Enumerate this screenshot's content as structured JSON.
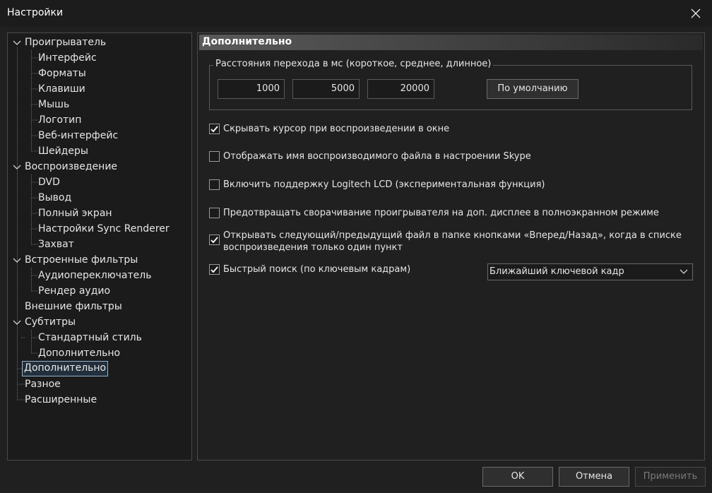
{
  "window": {
    "title": "Настройки"
  },
  "tree": {
    "items": [
      {
        "label": "Проигрыватель"
      },
      {
        "label": "Интерфейс"
      },
      {
        "label": "Форматы"
      },
      {
        "label": "Клавиши"
      },
      {
        "label": "Мышь"
      },
      {
        "label": "Логотип"
      },
      {
        "label": "Веб-интерфейс"
      },
      {
        "label": "Шейдеры"
      },
      {
        "label": "Воспроизведение"
      },
      {
        "label": "DVD"
      },
      {
        "label": "Вывод"
      },
      {
        "label": "Полный экран"
      },
      {
        "label": "Настройки Sync Renderer"
      },
      {
        "label": "Захват"
      },
      {
        "label": "Встроенные фильтры"
      },
      {
        "label": "Аудиопереключатель"
      },
      {
        "label": "Рендер аудио"
      },
      {
        "label": "Внешние фильтры"
      },
      {
        "label": "Субтитры"
      },
      {
        "label": "Стандартный стиль"
      },
      {
        "label": "Дополнительно"
      },
      {
        "label": "Дополнительно"
      },
      {
        "label": "Разное"
      },
      {
        "label": "Расширенные"
      }
    ],
    "selected": "Дополнительно"
  },
  "page": {
    "header": "Дополнительно",
    "jump_group": {
      "label": "Расстояния перехода в мс (короткое, среднее, длинное)",
      "short": "1000",
      "medium": "5000",
      "long": "20000",
      "default_button": "По умолчанию"
    },
    "options": [
      {
        "label": "Скрывать курсор при воспроизведении в окне",
        "checked": true
      },
      {
        "label": "Отображать имя воспроизводимого файла в настроении Skype",
        "checked": false
      },
      {
        "label": "Включить поддержку Logitech LCD (экспериментальная функция)",
        "checked": false
      },
      {
        "label": "Предотвращать сворачивание проигрывателя на доп. дисплее в полноэкранном режиме",
        "checked": false
      },
      {
        "label_line1": "Открывать следующий/предыдущий файл в папке кнопками «Вперед/Назад», когда в списке",
        "label_line2": "воспроизведения только один пункт",
        "checked": true
      },
      {
        "label": "Быстрый поиск (по ключевым кадрам)",
        "checked": true
      }
    ],
    "fast_seek_select": "Ближайший ключевой кадр"
  },
  "footer": {
    "ok": "OK",
    "cancel": "Отмена",
    "apply": "Применить"
  },
  "colors": {
    "background": "#202020",
    "accent": "#8fb3d1",
    "text": "#e6e6e6"
  }
}
